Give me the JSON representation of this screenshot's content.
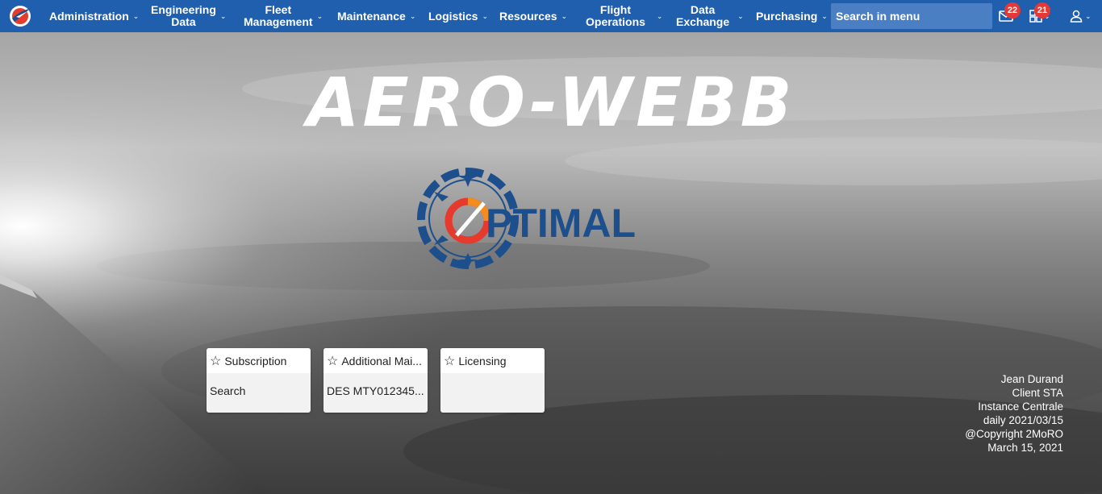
{
  "nav": {
    "items": [
      {
        "label": "Administration"
      },
      {
        "label": "Engineering\nData"
      },
      {
        "label": "Fleet\nManagement"
      },
      {
        "label": "Maintenance"
      },
      {
        "label": "Logistics"
      },
      {
        "label": "Resources"
      },
      {
        "label": "Flight\nOperations"
      },
      {
        "label": "Data\nExchange"
      },
      {
        "label": "Purchasing"
      }
    ],
    "search_placeholder": "Search in menu",
    "mail_badge": "22",
    "apps_badge": "21"
  },
  "title": "AERO-WEBB",
  "emblem_text": "PTIMAL",
  "tiles": [
    {
      "title": "Subscription",
      "body": "Search"
    },
    {
      "title": "Additional Mai...",
      "body": "DES MTY012345..."
    },
    {
      "title": "Licensing",
      "body": ""
    }
  ],
  "info": {
    "user": "Jean Durand",
    "client": "Client STA",
    "instance": "Instance Centrale",
    "build": "daily 2021/03/15",
    "copyright": "@Copyright 2MoRO",
    "date": "March 15, 2021"
  },
  "colors": {
    "nav_bg": "#1f5fae",
    "search_bg": "#4b7fc4",
    "badge": "#e53935",
    "emblem_blue": "#1d4f8c",
    "emblem_red": "#e63a2e",
    "emblem_orange": "#f28c1e"
  },
  "icons": {
    "mail": "mail-icon",
    "apps": "apps-grid-icon",
    "user": "user-icon",
    "star": "star-icon",
    "chevron": "chevron-down-icon"
  }
}
